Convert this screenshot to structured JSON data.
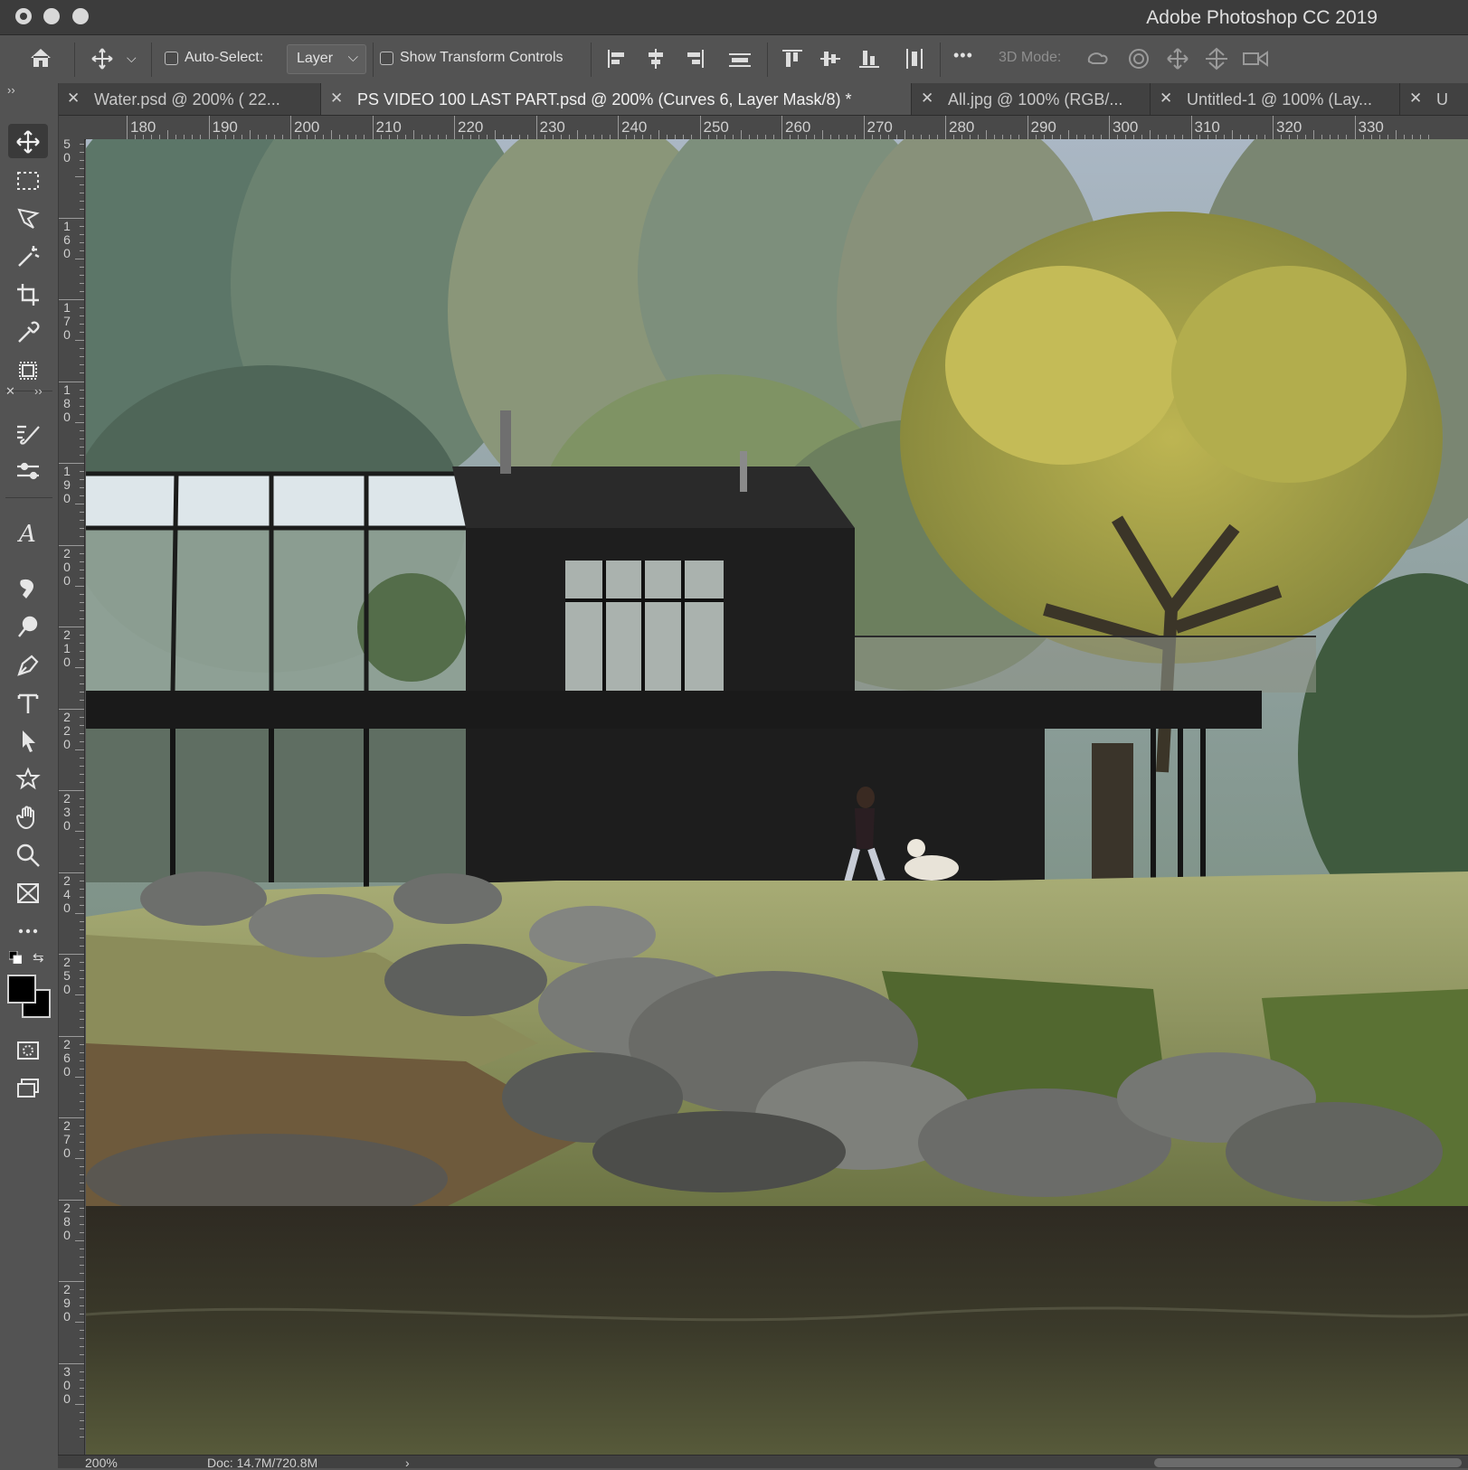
{
  "window": {
    "title": "Adobe Photoshop CC 2019"
  },
  "options_bar": {
    "auto_select_label": "Auto-Select:",
    "auto_select_value": "Layer",
    "show_transform_label": "Show Transform Controls",
    "mode_3d_label": "3D Mode:",
    "more_label": "•••"
  },
  "tabs": [
    {
      "label": "Water.psd @ 200% ( 22...",
      "active": false
    },
    {
      "label": "PS VIDEO 100 LAST PART.psd @ 200% (Curves 6, Layer Mask/8) *",
      "active": true
    },
    {
      "label": "All.jpg @ 100% (RGB/...",
      "active": false
    },
    {
      "label": "Untitled-1 @ 100% (Lay...",
      "active": false
    },
    {
      "label": "U",
      "active": false
    }
  ],
  "ruler_h": [
    "180",
    "190",
    "200",
    "210",
    "220",
    "230",
    "240",
    "250",
    "260",
    "270",
    "280",
    "290",
    "300",
    "310",
    "320",
    "330"
  ],
  "ruler_v": [
    [
      "5",
      "0"
    ],
    [
      "1",
      "6",
      "0"
    ],
    [
      "1",
      "7",
      "0"
    ],
    [
      "1",
      "8",
      "0"
    ],
    [
      "1",
      "9",
      "0"
    ],
    [
      "2",
      "0",
      "0"
    ],
    [
      "2",
      "1",
      "0"
    ],
    [
      "2",
      "2",
      "0"
    ],
    [
      "2",
      "3",
      "0"
    ],
    [
      "2",
      "4",
      "0"
    ],
    [
      "2",
      "5",
      "0"
    ],
    [
      "2",
      "6",
      "0"
    ],
    [
      "2",
      "7",
      "0"
    ],
    [
      "2",
      "8",
      "0"
    ],
    [
      "2",
      "9",
      "0"
    ],
    [
      "3",
      "0",
      "0"
    ]
  ],
  "tools": [
    "move-tool",
    "marquee-tool",
    "lasso-tool",
    "magic-wand-tool",
    "crop-tool",
    "eyedropper-tool",
    "frame-tool",
    "brush-tool",
    "adjustment-tool",
    "type-art-tool",
    "smudge-tool",
    "dodge-tool",
    "pen-tool",
    "type-tool",
    "path-selection-tool",
    "custom-shape-tool",
    "hand-tool",
    "zoom-tool",
    "frame-box-tool",
    "more-tools"
  ],
  "status": {
    "zoom": "200%",
    "doc": "Doc: 14.7M/720.8M",
    "arrow": "›"
  },
  "colors": {
    "foreground": "#000000",
    "background": "#000000",
    "ui_dark": "#3c3c3c",
    "ui_mid": "#535353"
  }
}
